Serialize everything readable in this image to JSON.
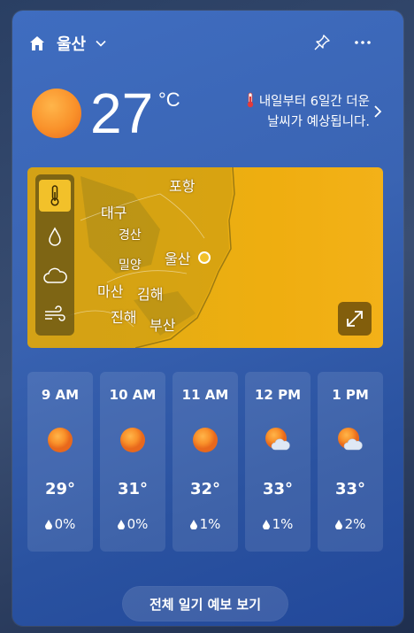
{
  "header": {
    "location": "울산",
    "home_icon": "home-icon",
    "chevron_icon": "chevron-down-icon",
    "pin_icon": "pin-icon",
    "more_icon": "more-icon"
  },
  "current": {
    "temperature": "27",
    "unit": "°C",
    "condition_icon": "sunny-icon",
    "alert_line1": "내일부터 6일간 더운",
    "alert_line2": "날씨가 예상됩니다."
  },
  "map": {
    "labels": {
      "pohang": "포항",
      "daegu": "대구",
      "gyeongsan": "경산",
      "ulsan": "울산",
      "miryang": "밀양",
      "masan": "마산",
      "gimhae": "김해",
      "jinhae": "진해",
      "busan": "부산"
    },
    "layers": [
      "temperature-layer-icon",
      "precipitation-layer-icon",
      "cloud-layer-icon",
      "wind-layer-icon"
    ],
    "active_layer": "temperature"
  },
  "hourly": [
    {
      "time": "9 AM",
      "icon": "sunny-icon",
      "temp": "29°",
      "precip": "0%"
    },
    {
      "time": "10 AM",
      "icon": "sunny-icon",
      "temp": "31°",
      "precip": "0%"
    },
    {
      "time": "11 AM",
      "icon": "sunny-icon",
      "temp": "32°",
      "precip": "1%"
    },
    {
      "time": "12 PM",
      "icon": "partly-cloudy-icon",
      "temp": "33°",
      "precip": "1%"
    },
    {
      "time": "1 PM",
      "icon": "partly-cloudy-icon",
      "temp": "33°",
      "precip": "2%"
    }
  ],
  "footer": {
    "forecast_button": "전체 일기 예보 보기"
  },
  "colors": {
    "card_bg": "#3a64b3",
    "map_bg": "#e9ad14",
    "active_tool": "#f2c12a"
  }
}
